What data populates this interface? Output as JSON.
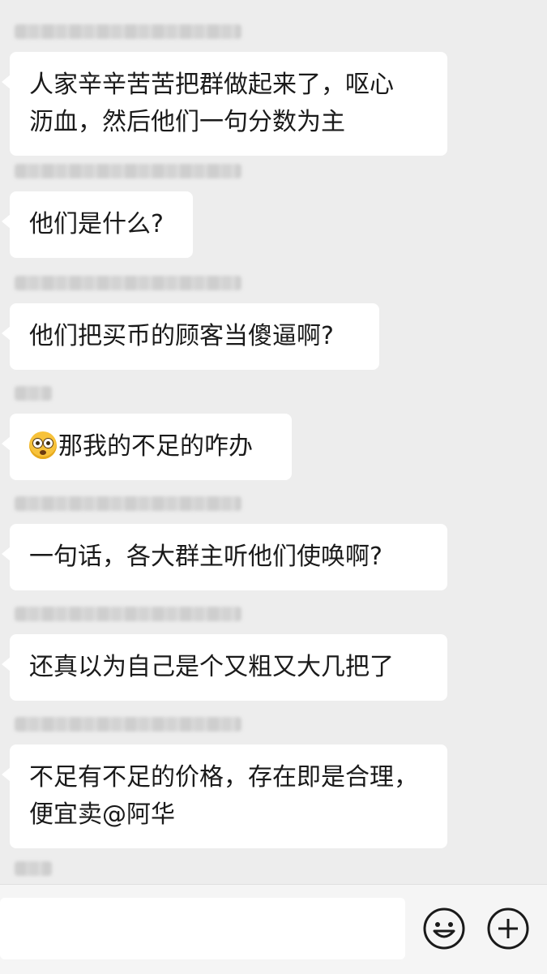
{
  "messages": [
    {
      "sender_blurred": true,
      "text_lines": [
        "人家辛辛苦苦把群做起来了，呕心",
        "沥血，然后他们一句分数为主"
      ]
    },
    {
      "sender_blurred": true,
      "text_lines": [
        "他们是什么?"
      ]
    },
    {
      "sender_blurred": true,
      "text_lines": [
        "他们把买币的顾客当傻逼啊?"
      ]
    },
    {
      "sender_blurred": true,
      "emoji": "flushed-face-icon",
      "text_lines": [
        "那我的不足的咋办"
      ]
    },
    {
      "sender_blurred": true,
      "text_lines": [
        "一句话，各大群主听他们使唤啊?"
      ]
    },
    {
      "sender_blurred": true,
      "text_lines": [
        "还真以为自己是个又粗又大几把了"
      ]
    },
    {
      "sender_blurred": true,
      "text_lines": [
        "不足有不足的价格，存在即是合理，",
        "便宜卖@阿华"
      ]
    }
  ],
  "input_bar": {
    "value": "",
    "emoji_icon": "smiley-icon",
    "plus_icon": "plus-icon"
  },
  "colors": {
    "background": "#ededed",
    "bubble": "#ffffff",
    "text": "#1a1a1a"
  }
}
